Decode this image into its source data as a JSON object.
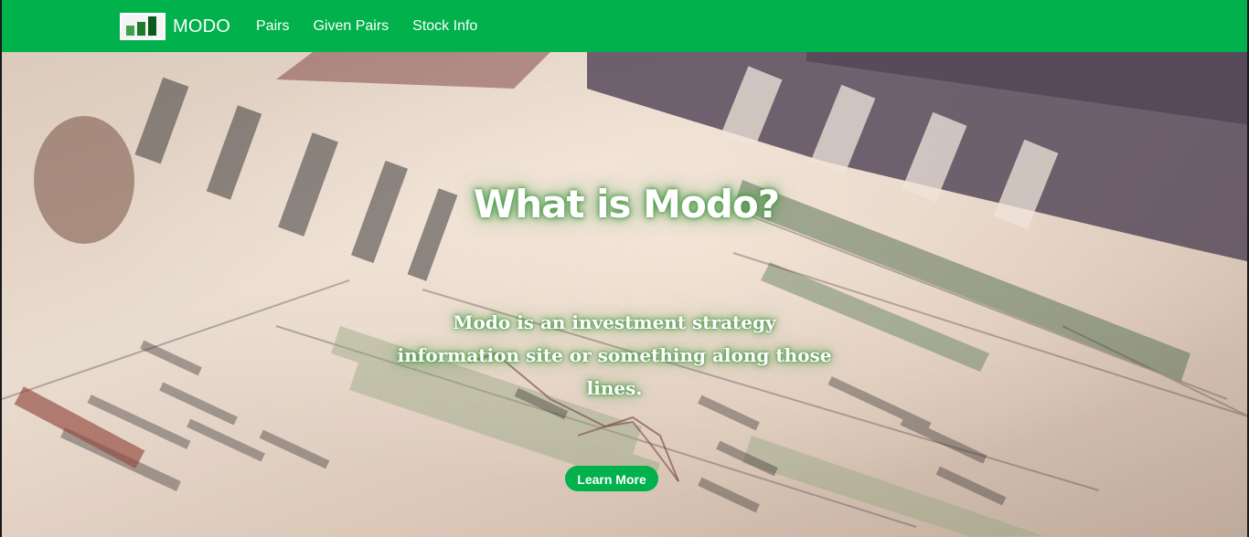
{
  "navbar": {
    "brand_name": "MODO",
    "links": [
      "Pairs",
      "Given Pairs",
      "Stock Info"
    ],
    "bg_color": "#00b14c"
  },
  "hero": {
    "title": "What is Modo?",
    "description": "Modo is an investment strategy information site or something along those lines.",
    "button_label": "Learn More",
    "background_image": "newspaper financial pages"
  },
  "icons": {
    "logo": "bar-chart-logo-icon"
  }
}
